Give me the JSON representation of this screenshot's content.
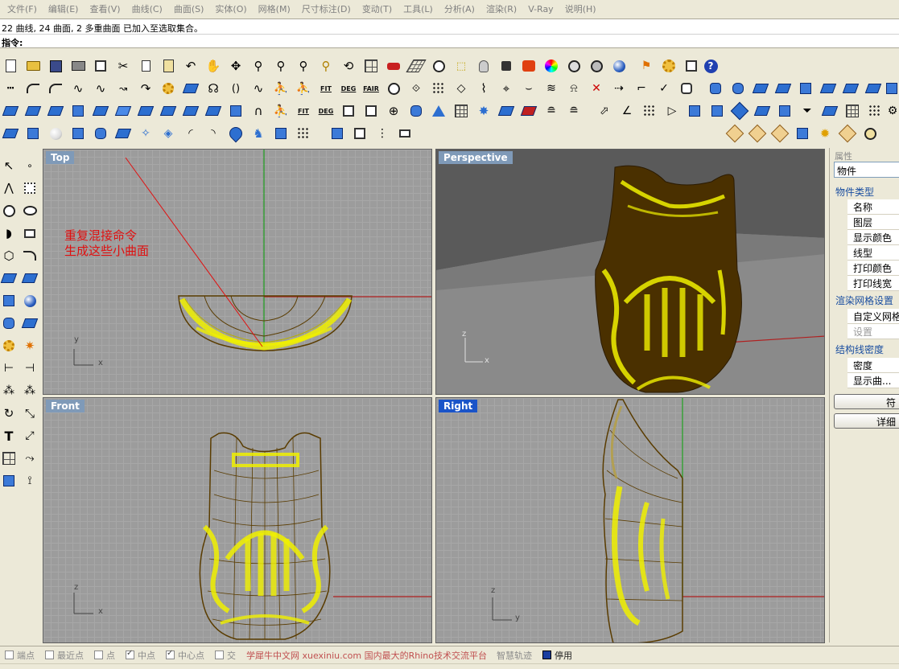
{
  "menubar": [
    "文件(F)",
    "编辑(E)",
    "查看(V)",
    "曲线(C)",
    "曲面(S)",
    "实体(O)",
    "网格(M)",
    "尺寸标注(D)",
    "变动(T)",
    "工具(L)",
    "分析(A)",
    "渲染(R)",
    "V-Ray",
    "说明(H)"
  ],
  "command_history": "22 曲线, 24 曲面, 2 多重曲面 已加入至选取集合。",
  "command_prompt": "指令:",
  "viewports": {
    "top": {
      "title": "Top",
      "axis_y": "y",
      "axis_x": "x"
    },
    "perspective": {
      "title": "Perspective",
      "axis_z": "z",
      "axis_x": "x"
    },
    "front": {
      "title": "Front",
      "axis_z": "z",
      "axis_x": "x"
    },
    "right": {
      "title": "Right",
      "axis_z": "z",
      "axis_y": "y"
    }
  },
  "annotation": {
    "line1": "重复混接命令",
    "line2": "生成这些小曲面",
    "color": "#e01010"
  },
  "toolbar_text": {
    "fit": "FIT",
    "deg": "DEG",
    "fair": "FAIR"
  },
  "properties": {
    "title": "属性",
    "tab": "物件",
    "section_type": "物件类型",
    "rows_type": [
      "名称",
      "图层",
      "显示颜色",
      "线型",
      "打印颜色",
      "打印线宽"
    ],
    "section_mesh": "渲染网格设置",
    "row_mesh_custom": "自定义网格",
    "row_mesh_settings": "设置",
    "section_iso": "结构线密度",
    "row_density": "密度",
    "row_show_curve": "显示曲...",
    "btn_match": "符",
    "btn_detail": "详细"
  },
  "statusbar": {
    "snaps": [
      {
        "label": "端点",
        "checked": false
      },
      {
        "label": "最近点",
        "checked": false
      },
      {
        "label": "点",
        "checked": false
      },
      {
        "label": "中点",
        "checked": true
      },
      {
        "label": "中心点",
        "checked": true
      },
      {
        "label": "交",
        "checked": false
      }
    ],
    "watermark": "学犀牛中文网 xuexiniu.com 国内最大的Rhino技术交流平台",
    "smart_track": "智慧轨迹",
    "pause": "停用"
  },
  "colors": {
    "accent": "#1a54c8",
    "model_line": "#5a3c00",
    "highlight": "#f0f000",
    "red_axis": "#b02020",
    "green_axis": "#20a020"
  }
}
